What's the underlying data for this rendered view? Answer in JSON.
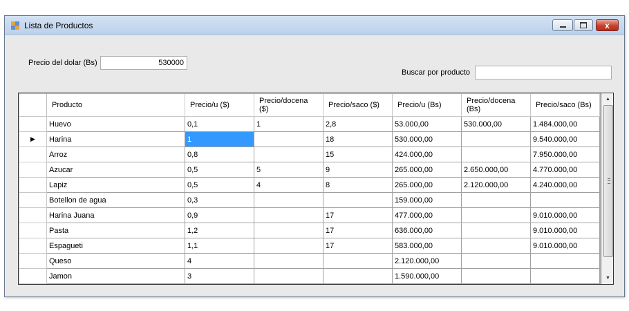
{
  "window": {
    "title": "Lista de Productos",
    "close_glyph": "x"
  },
  "form": {
    "precio_dolar_label": "Precio del dolar (Bs)",
    "precio_dolar_value": "530000",
    "buscar_label": "Buscar por producto",
    "buscar_value": ""
  },
  "grid": {
    "columns": [
      "Producto",
      "Precio/u ($)",
      "Precio/docena ($)",
      "Precio/saco ($)",
      "Precio/u (Bs)",
      "Precio/docena (Bs)",
      "Precio/saco (Bs)"
    ],
    "current_row_marker": "▶",
    "rows": [
      [
        "Huevo",
        "0,1",
        "1",
        "2,8",
        "53.000,00",
        "530.000,00",
        "1.484.000,00"
      ],
      [
        "Harina",
        "1",
        "",
        "18",
        "530.000,00",
        "",
        "9.540.000,00"
      ],
      [
        "Arroz",
        "0,8",
        "",
        "15",
        "424.000,00",
        "",
        "7.950.000,00"
      ],
      [
        "Azucar",
        "0,5",
        "5",
        "9",
        "265.000,00",
        "2.650.000,00",
        "4.770.000,00"
      ],
      [
        "Lapiz",
        "0,5",
        "4",
        "8",
        "265.000,00",
        "2.120.000,00",
        "4.240.000,00"
      ],
      [
        "Botellon de agua",
        "0,3",
        "",
        "",
        "159.000,00",
        "",
        ""
      ],
      [
        "Harina Juana",
        "0,9",
        "",
        "17",
        "477.000,00",
        "",
        "9.010.000,00"
      ],
      [
        "Pasta",
        "1,2",
        "",
        "17",
        "636.000,00",
        "",
        "9.010.000,00"
      ],
      [
        "Espagueti",
        "1,1",
        "",
        "17",
        "583.000,00",
        "",
        "9.010.000,00"
      ],
      [
        "Queso",
        "4",
        "",
        "",
        "2.120.000,00",
        "",
        ""
      ],
      [
        "Jamon",
        "3",
        "",
        "",
        "1.590.000,00",
        "",
        ""
      ]
    ]
  },
  "colors": {
    "selection": "#3399ff",
    "titlebar": "#c6d8ee",
    "close_button": "#c8412f"
  }
}
